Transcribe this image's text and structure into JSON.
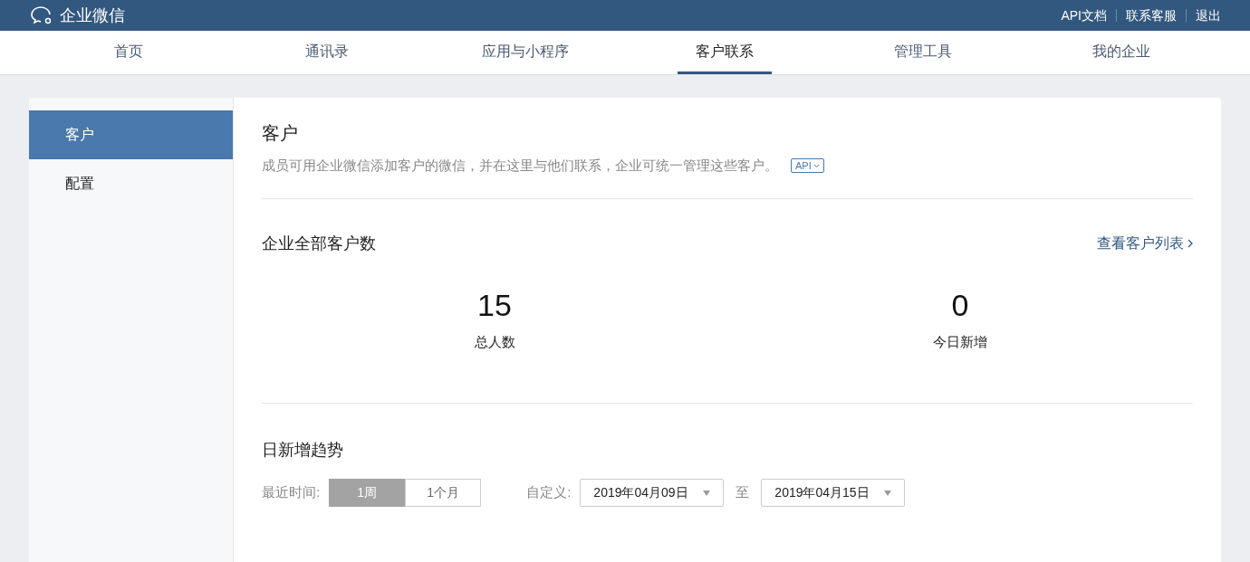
{
  "header": {
    "logo_text": "企业微信",
    "links": [
      "API文档",
      "联系客服",
      "退出"
    ]
  },
  "nav": [
    {
      "label": "首页",
      "selected": false
    },
    {
      "label": "通讯录",
      "selected": false
    },
    {
      "label": "应用与小程序",
      "selected": false
    },
    {
      "label": "客户联系",
      "selected": true
    },
    {
      "label": "管理工具",
      "selected": false
    },
    {
      "label": "我的企业",
      "selected": false
    }
  ],
  "sidebar": {
    "items": [
      {
        "label": "客户",
        "selected": true
      },
      {
        "label": "配置",
        "selected": false
      }
    ]
  },
  "page": {
    "title": "客户",
    "description": "成员可用企业微信添加客户的微信，并在这里与他们联系，企业可统一管理这些客户。",
    "api_badge": "API"
  },
  "stats": {
    "title": "企业全部客户数",
    "link": "查看客户列表",
    "items": [
      {
        "value": "15",
        "label": "总人数"
      },
      {
        "value": "0",
        "label": "今日新增"
      }
    ]
  },
  "trend": {
    "title": "日新增趋势",
    "range_label": "最近时间:",
    "ranges": [
      {
        "label": "1周",
        "selected": true
      },
      {
        "label": "1个月",
        "selected": false
      }
    ],
    "custom_label": "自定义:",
    "start_date": "2019年04月09日",
    "separator": "至",
    "end_date": "2019年04月15日"
  }
}
